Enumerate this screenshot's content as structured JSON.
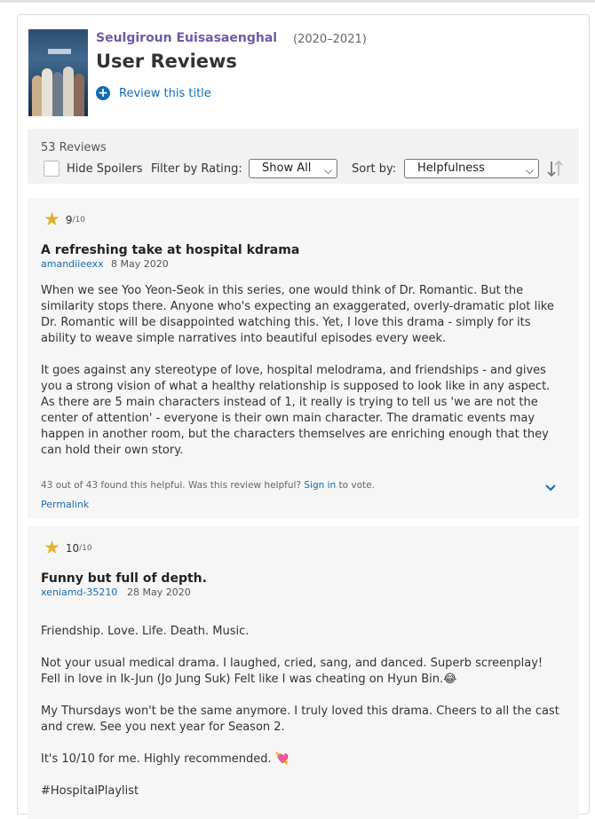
{
  "header": {
    "show_title": "Seulgiroun Euisasaenghal",
    "years": "(2020–2021)",
    "heading": "User Reviews",
    "review_title_label": "Review this title"
  },
  "filters": {
    "review_count": "53 Reviews",
    "hide_spoilers": "Hide Spoilers",
    "filter_label": "Filter by Rating:",
    "filter_value": "Show All",
    "sort_label": "Sort by:",
    "sort_value": "Helpfulness"
  },
  "reviews": [
    {
      "rating": "9",
      "rating_max": "/10",
      "title": "A refreshing take at hospital kdrama",
      "author": "amandiieexx",
      "date": "8 May 2020",
      "paragraphs": [
        "When we see Yoo Yeon-Seok in this series, one would think of Dr. Romantic. But the similarity stops there. Anyone who's expecting an exaggerated, overly-dramatic plot like Dr. Romantic will be disappointed watching this. Yet, I love this drama - simply for its ability to weave simple narratives into beautiful episodes every week.",
        "It goes against any stereotype of love, hospital melodrama, and friendships - and gives you a strong vision of what a healthy relationship is supposed to look like in any aspect. As there are 5 main characters instead of 1, it really is trying to tell us 'we are not the center of attention' - everyone is their own main character. The dramatic events may happen in another room, but the characters themselves are enriching enough that they can hold their own story."
      ],
      "helpful_text": "43 out of 43 found this helpful. Was this review helpful?",
      "sign_in": "Sign in",
      "to_vote": "to vote.",
      "permalink": "Permalink"
    },
    {
      "rating": "10",
      "rating_max": "/10",
      "title": "Funny but full of depth.",
      "author": "xeniamd-35210",
      "date": "28 May 2020",
      "paragraphs": [
        "Friendship. Love. Life. Death. Music.",
        "Not your usual medical drama. I laughed, cried, sang, and danced. Superb screenplay! Fell in love in Ik-Jun (Jo Jung Suk) Felt like I was cheating on Hyun Bin.😂",
        "My Thursdays won't be the same anymore. I truly loved this drama. Cheers to all the cast and crew. See you next year for Season 2.",
        "It's 10/10 for me. Highly recommended. 💘",
        "#HospitalPlaylist"
      ]
    }
  ],
  "colors": {
    "link": "#136cb2",
    "title_link": "#6f5aa6",
    "star": "#e3b22a",
    "review_bg": "#f6f6f6"
  }
}
